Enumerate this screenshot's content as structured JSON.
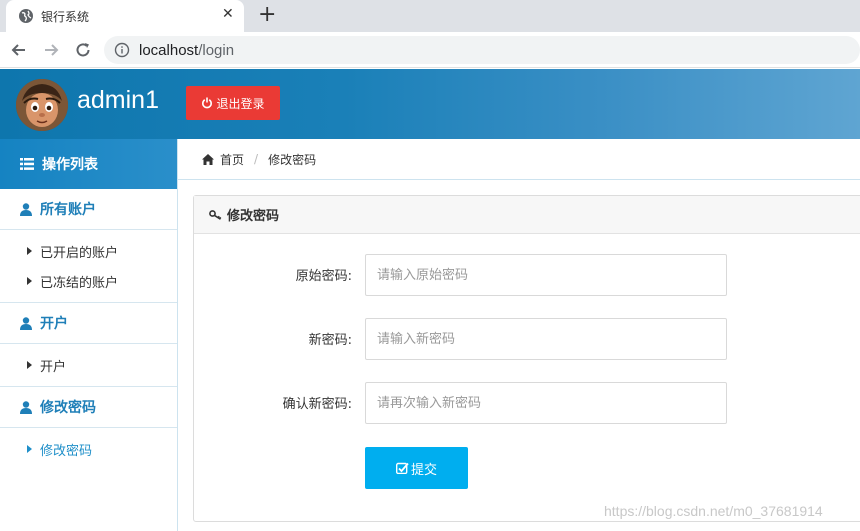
{
  "browser": {
    "tab_title": "银行系统",
    "tab_close": "✕",
    "new_tab": "+",
    "url_host": "localhost",
    "url_path": "/login"
  },
  "header": {
    "username": "admin1",
    "logout_label": "退出登录"
  },
  "sidebar": {
    "heading": "操作列表",
    "groups": [
      {
        "title": "所有账户",
        "items": [
          {
            "label": "已开启的账户"
          },
          {
            "label": "已冻结的账户"
          }
        ]
      },
      {
        "title": "开户",
        "items": [
          {
            "label": "开户"
          }
        ]
      },
      {
        "title": "修改密码",
        "items": [
          {
            "label": "修改密码",
            "active": true
          }
        ]
      }
    ]
  },
  "breadcrumb": {
    "home": "首页",
    "separator": "/",
    "current": "修改密码"
  },
  "panel": {
    "title": "修改密码",
    "fields": [
      {
        "label": "原始密码:",
        "placeholder": "请输入原始密码",
        "value": ""
      },
      {
        "label": "新密码:",
        "placeholder": "请输入新密码",
        "value": ""
      },
      {
        "label": "确认新密码:",
        "placeholder": "请再次输入新密码",
        "value": ""
      }
    ],
    "submit_label": "提交"
  },
  "watermark": "https://blog.csdn.net/m0_37681914",
  "colors": {
    "header_bg": "#0e76ad",
    "logout_bg": "#ea3a35",
    "accent": "#1f7fb8",
    "submit_bg": "#00aeef"
  }
}
